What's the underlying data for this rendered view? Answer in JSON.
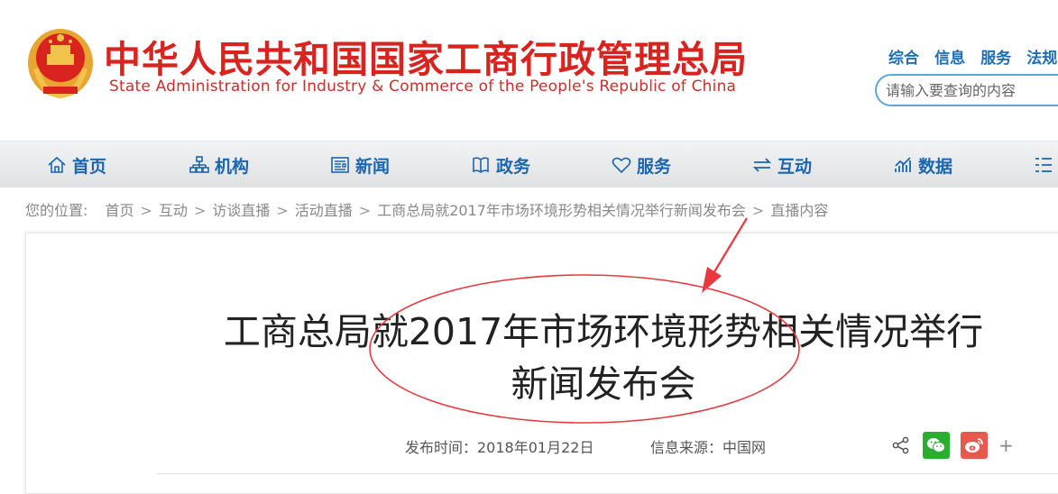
{
  "header": {
    "title_cn": "中华人民共和国国家工商行政管理总局",
    "title_en": "State Administration for Industry & Commerce of the People's Republic of China",
    "top_links": [
      "综合",
      "信息",
      "服务",
      "法规"
    ],
    "search": {
      "placeholder": "请输入要查询的内容"
    }
  },
  "nav": {
    "items": [
      {
        "label": "首页",
        "icon": "home-icon"
      },
      {
        "label": "机构",
        "icon": "org-chart-icon"
      },
      {
        "label": "新闻",
        "icon": "newspaper-icon"
      },
      {
        "label": "政务",
        "icon": "book-icon"
      },
      {
        "label": "服务",
        "icon": "heart-icon"
      },
      {
        "label": "互动",
        "icon": "exchange-icon"
      },
      {
        "label": "数据",
        "icon": "chart-icon"
      },
      {
        "label": "",
        "icon": "list-icon"
      }
    ]
  },
  "breadcrumb": {
    "prefix": "您的位置:",
    "items": [
      "首页",
      "互动",
      "访谈直播",
      "活动直播",
      "工商总局就2017年市场环境形势相关情况举行新闻发布会",
      "直播内容"
    ]
  },
  "article": {
    "title_line1": "工商总局就2017年市场环境形势相关情况举行",
    "title_line2": "新闻发布会",
    "publish_time": "发布时间：2018年01月22日",
    "source": "信息来源：中国网",
    "share_plus": "+"
  },
  "colors": {
    "brand_red": "#d8231f",
    "nav_blue": "#1a66b0",
    "annotation_red": "#e8383d",
    "wechat_green": "#2aae31",
    "weibo_red": "#e7594d"
  }
}
